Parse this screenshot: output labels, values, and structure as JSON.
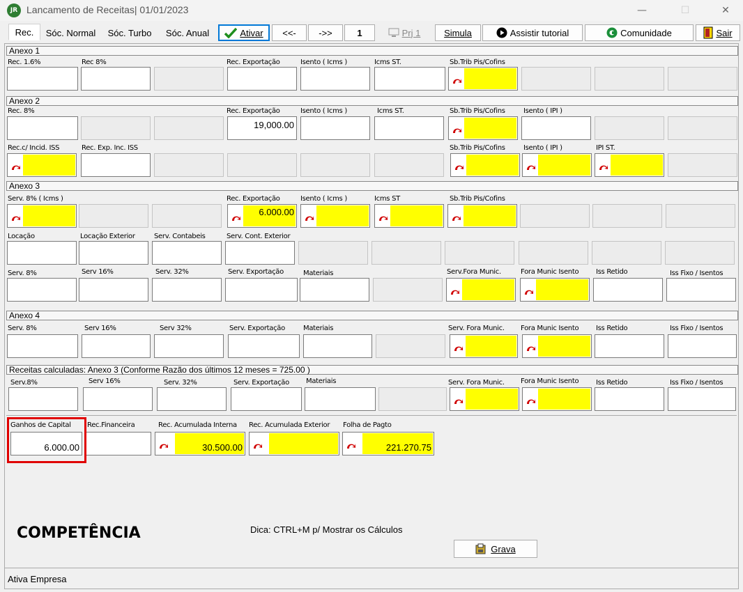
{
  "window": {
    "app_icon_text": "JR",
    "title": "Lancamento de Receitas|  01/01/2023",
    "minimize": "—",
    "maximize": "☐",
    "close": "✕"
  },
  "toolbar": {
    "tabs": [
      "Rec.",
      "Sóc. Normal",
      "Sóc. Turbo",
      "Sóc. Anual"
    ],
    "ativar": "Ativar",
    "prev": "<<-",
    "next": "->>",
    "page": "1",
    "prj": "Prj 1",
    "simula": "Simula",
    "tutorial": "Assistir tutorial",
    "comunidade": "Comunidade",
    "sair": "Sair"
  },
  "anexo1": {
    "header": "Anexo 1",
    "labels": [
      "Rec. 1.6%",
      "Rec 8%",
      "Rec. Exportação",
      "Isento ( Icms )",
      "Icms ST.",
      "Sb.Trib Pis/Cofins"
    ]
  },
  "anexo2": {
    "header": "Anexo 2",
    "row1_labels": [
      "Rec. 8%",
      "Rec. Exportação",
      "Isento ( Icms )",
      "Icms ST.",
      "Sb.Trib Pis/Cofins",
      "Isento ( IPI )"
    ],
    "rec_exportacao": "19,000.00",
    "row2_labels": [
      "Rec.c/ Incid. ISS",
      "Rec. Exp. Inc. ISS",
      "Sb.Trib Pis/Cofins",
      "Isento ( IPI )",
      "IPI ST."
    ]
  },
  "anexo3": {
    "header": "Anexo 3",
    "row1_labels": [
      "Serv. 8% ( Icms )",
      "Rec. Exportação",
      "Isento ( Icms )",
      "Icms ST",
      "Sb.Trib Pis/Cofins"
    ],
    "rec_exportacao": "6.000.00",
    "row2_labels": [
      "Locação",
      "Locação Exterior",
      "Serv. Contabeis",
      "Serv. Cont. Exterior"
    ],
    "row3_labels": [
      "Serv. 8%",
      "Serv 16%",
      "Serv. 32%",
      "Serv. Exportação",
      "Materiais",
      "Serv.Fora Munic.",
      "Fora Munic Isento",
      "Iss Retido",
      "Iss Fixo / Isentos"
    ]
  },
  "anexo4": {
    "header": "Anexo 4",
    "labels": [
      "Serv. 8%",
      "Serv 16%",
      "Serv 32%",
      "Serv. Exportação",
      "Materiais",
      "Serv. Fora Munic.",
      "Fora Munic Isento",
      "Iss Retido",
      "Iss Fixo / Isentos"
    ]
  },
  "calculadas": {
    "header": "Receitas calculadas: Anexo 3 (Conforme Razão dos últimos 12 meses = 725.00 )",
    "labels": [
      "Serv.8%",
      "Serv 16%",
      "Serv. 32%",
      "Serv. Exportação",
      "Materiais",
      "Serv. Fora Munic.",
      "Fora Munic Isento",
      "Iss Retido",
      "Iss Fixo / Isentos"
    ]
  },
  "bottom": {
    "labels": [
      "Ganhos de Capital",
      "Rec.Financeira",
      "Rec. Acumulada Interna",
      "Rec. Acumulada Exterior",
      "Folha de Pagto"
    ],
    "ganhos_capital": "6.000.00",
    "rec_acumulada_interna": "30.500.00",
    "folha_pagto": "221.270.75"
  },
  "competencia": "COMPETÊNCIA",
  "hint": "Dica: CTRL+M p/ Mostrar os Cálculos",
  "grava": "Grava",
  "status": "Ativa Empresa",
  "colors": {
    "yellow": "#ffff00",
    "highlight": "#e00000",
    "focus": "#0078d7"
  }
}
